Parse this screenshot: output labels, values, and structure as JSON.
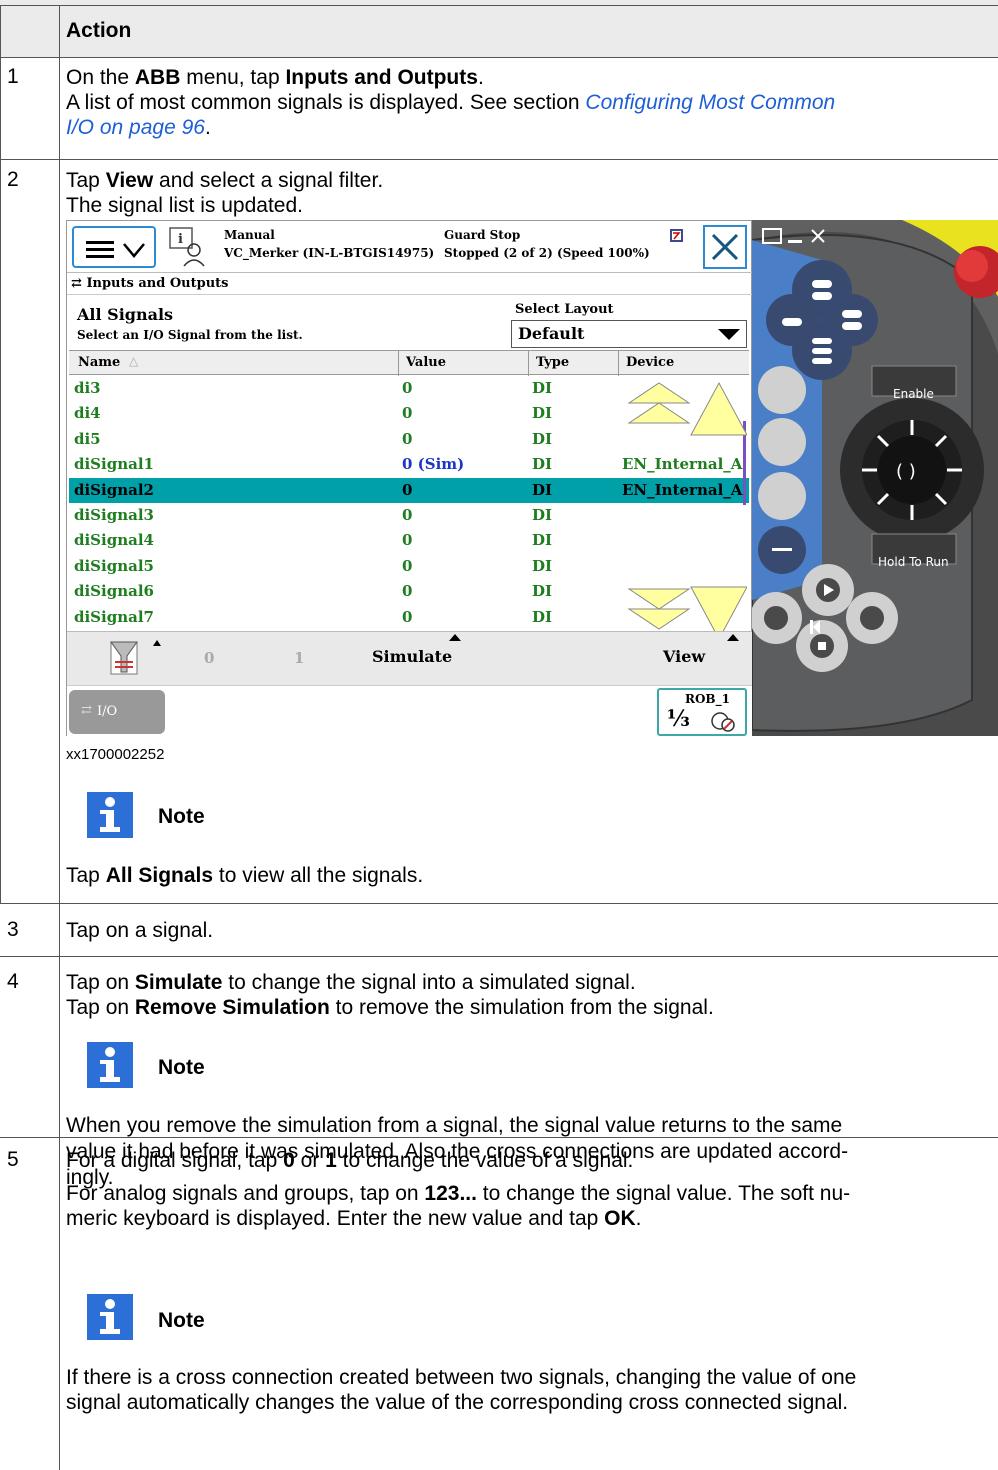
{
  "table": {
    "header_action": "Action",
    "steps": [
      {
        "num": "1",
        "line1_pre": "On the ",
        "line1_b1": "ABB",
        "line1_mid": " menu, tap ",
        "line1_b2": "Inputs and Outputs",
        "line1_post": ".",
        "line2": "A list of most common signals is displayed. See section ",
        "link1": "Configuring Most Common",
        "link2": "I/O on page 96",
        "line3_post": "."
      },
      {
        "num": "2",
        "line1_pre": "Tap ",
        "line1_b1": "View",
        "line1_post": " and select a signal filter.",
        "line2": "The signal list is updated.",
        "figure_id": "xx1700002252",
        "note_title": "Note",
        "note_pre": "Tap ",
        "note_b": "All Signals",
        "note_post": " to view all the signals."
      },
      {
        "num": "3",
        "text": "Tap on a signal."
      },
      {
        "num": "4",
        "line1_pre": "Tap on ",
        "line1_b": "Simulate",
        "line1_post": " to change the signal into a simulated signal.",
        "line2_pre": "Tap on ",
        "line2_b": "Remove Simulation",
        "line2_post": " to remove the simulation from the signal.",
        "note_title": "Note",
        "note_l1": "When you remove the simulation from a signal, the signal value returns to the same",
        "note_l2": "value it had before it was simulated. Also the cross connections are updated accord-",
        "note_l3": "ingly."
      },
      {
        "num": "5",
        "line1_pre": "For a digital signal, tap ",
        "line1_b1": "0",
        "line1_mid": " or ",
        "line1_b2": "1",
        "line1_post": " to change the value of a signal.",
        "line2_pre": "For analog signals and groups, tap on ",
        "line2_b": "123...",
        "line2_post": " to change the signal value. The soft nu-",
        "line3_pre": "meric keyboard is displayed. Enter the new value and tap ",
        "line3_b": "OK",
        "line3_post": ".",
        "note_title": "Note",
        "note_l1": "If there is a cross connection created between two signals, changing the value of one",
        "note_l2": "signal automatically changes the value of the corresponding cross connected signal."
      }
    ]
  },
  "flexpendant": {
    "mode": "Manual",
    "controller": "VC_Merker (IN-L-BTGIS14975)",
    "status1": "Guard Stop",
    "status2": "Stopped (2 of 2) (Speed 100%)",
    "breadcrumb": "Inputs and Outputs",
    "list_title": "All Signals",
    "list_subtitle": "Select an I/O Signal from the list.",
    "layout_label": "Select Layout",
    "layout_value": "Default",
    "columns": [
      "Name",
      "Value",
      "Type",
      "Device"
    ],
    "rows": [
      {
        "name": "di3",
        "value": "0",
        "type": "DI",
        "device": ""
      },
      {
        "name": "di4",
        "value": "0",
        "type": "DI",
        "device": ""
      },
      {
        "name": "di5",
        "value": "0",
        "type": "DI",
        "device": ""
      },
      {
        "name": "diSignal1",
        "value": "0 (Sim)",
        "type": "DI",
        "device": "EN_Internal_A"
      },
      {
        "name": "diSignal2",
        "value": "0",
        "type": "DI",
        "device": "EN_Internal_A"
      },
      {
        "name": "diSignal3",
        "value": "0",
        "type": "DI",
        "device": ""
      },
      {
        "name": "diSignal4",
        "value": "0",
        "type": "DI",
        "device": ""
      },
      {
        "name": "diSignal5",
        "value": "0",
        "type": "DI",
        "device": ""
      },
      {
        "name": "diSignal6",
        "value": "0",
        "type": "DI",
        "device": ""
      },
      {
        "name": "diSignal7",
        "value": "0",
        "type": "DI",
        "device": ""
      }
    ],
    "selected_row": 4,
    "cmd_zero": "0",
    "cmd_one": "1",
    "cmd_simulate": "Simulate",
    "cmd_view": "View",
    "io_tab": "I/O",
    "rob_label": "ROB_1",
    "rob_fraction": "⅓",
    "enable_label": "Enable",
    "hold_label": "Hold To Run"
  }
}
